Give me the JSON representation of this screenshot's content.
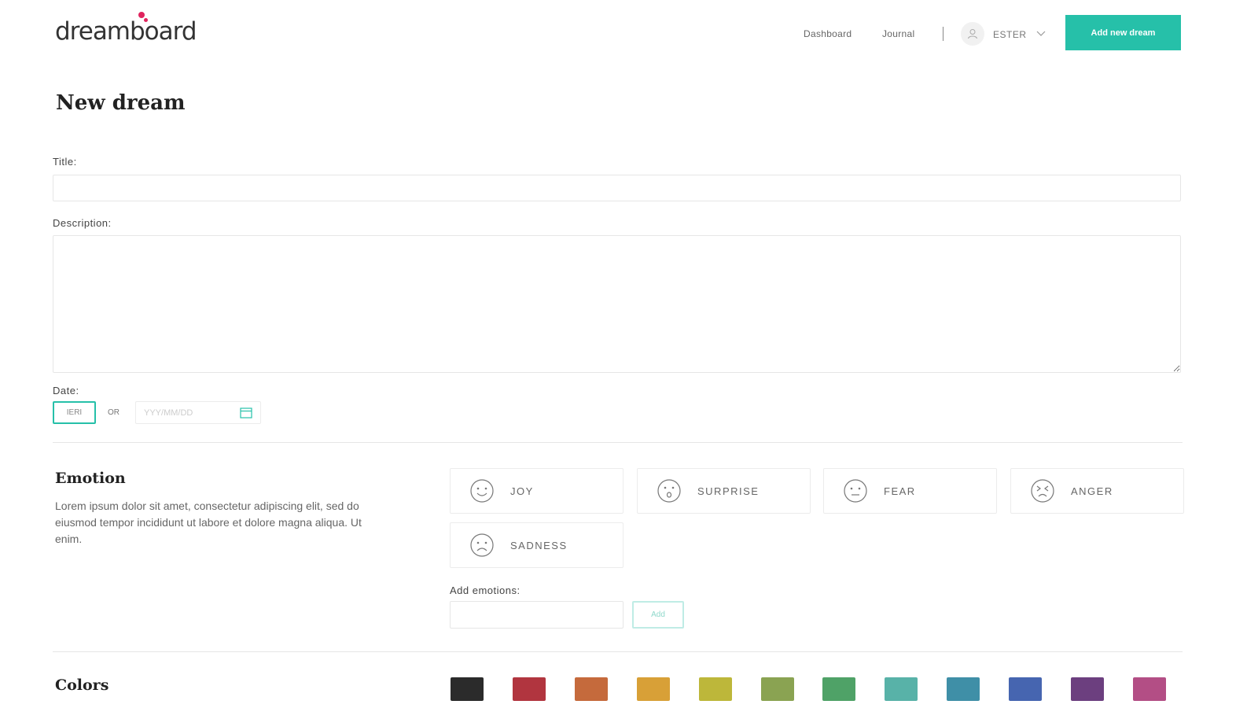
{
  "header": {
    "logo": "dreamboard",
    "nav": [
      {
        "label": "Dashboard"
      },
      {
        "label": "Journal"
      }
    ],
    "user": {
      "name": "ESTER"
    },
    "primary_button": "Add new dream"
  },
  "form": {
    "title": "New dream",
    "title_label": "Title:",
    "description_label": "Description:",
    "date_label": "Date:",
    "date_toggle": "IERI",
    "or_text": "OR",
    "date_placeholder": "YYY/MM/DD"
  },
  "emotion": {
    "heading": "Emotion",
    "description": "Lorem ipsum dolor sit amet, consectetur adipiscing elit, sed do eiusmod tempor incididunt ut labore et dolore magna aliqua. Ut enim.",
    "options": [
      {
        "label": "JOY",
        "icon": "smile-icon"
      },
      {
        "label": "SURPRISE",
        "icon": "surprised-face-icon"
      },
      {
        "label": "FEAR",
        "icon": "worried-face-icon"
      },
      {
        "label": "ANGER",
        "icon": "angry-face-icon"
      },
      {
        "label": "SADNESS",
        "icon": "sad-face-icon"
      }
    ],
    "add_label": "Add emotions:",
    "add_button": "Add"
  },
  "colors": {
    "heading": "Colors",
    "swatches": [
      "#2b2b2b",
      "#b1353f",
      "#c56a3c",
      "#d8a037",
      "#bdb73a",
      "#8aa352",
      "#4fa267",
      "#58b2a8",
      "#3f8fa7",
      "#4665b0",
      "#6c3f7f",
      "#b34e85"
    ]
  },
  "theme": {
    "accent": "#26c0a9",
    "brand_dot": "#e0245e"
  }
}
